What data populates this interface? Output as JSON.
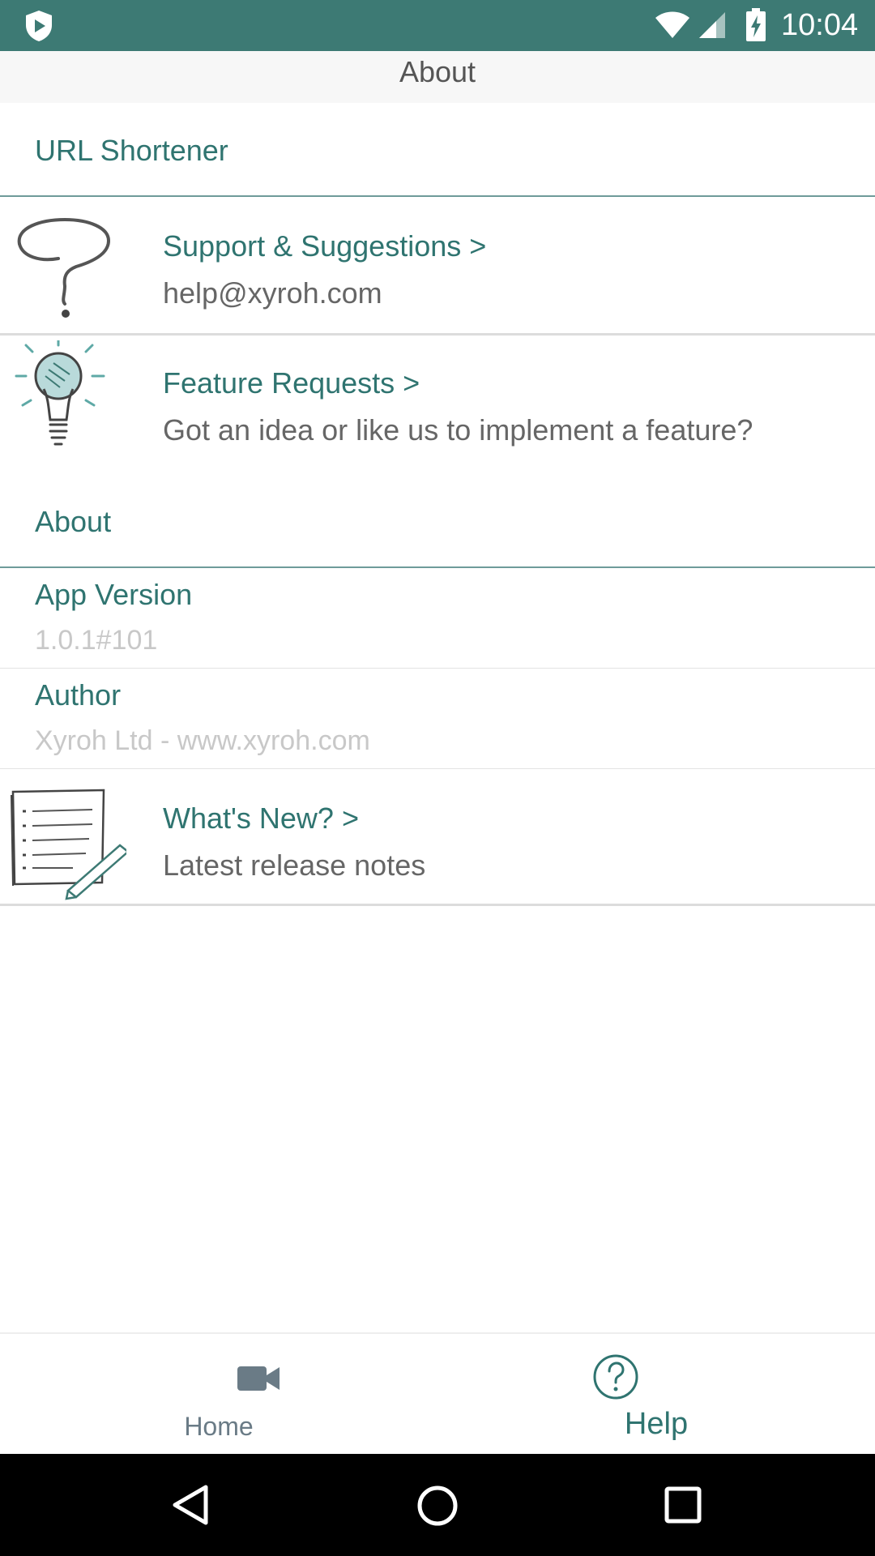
{
  "status_bar": {
    "time": "10:04",
    "icons": [
      "shield-play-icon",
      "wifi-icon",
      "cell-signal-icon",
      "battery-charging-icon"
    ],
    "background": "#3d7a74"
  },
  "header": {
    "title": "About"
  },
  "sections": {
    "app_name": "URL Shortener",
    "about": "About"
  },
  "support": {
    "title": "Support & Suggestions >",
    "subtitle": "help@xyroh.com",
    "icon": "question-mark-sketch-icon"
  },
  "feature_requests": {
    "title": "Feature Requests >",
    "subtitle": "Got an idea or like us to implement a feature?",
    "icon": "lightbulb-sketch-icon"
  },
  "app_version": {
    "label": "App Version",
    "value": "1.0.1#101"
  },
  "author": {
    "label": "Author",
    "value": "Xyroh Ltd - www.xyroh.com"
  },
  "whats_new": {
    "title": "What's New? >",
    "subtitle": "Latest release notes",
    "icon": "notepad-pencil-sketch-icon"
  },
  "bottom_nav": {
    "home_label": "Home",
    "help_label": "Help",
    "home_icon": "video-camera-icon",
    "help_icon": "question-circle-icon",
    "active": "Help"
  },
  "system_nav": {
    "icons": [
      "back-icon",
      "home-circle-icon",
      "recents-icon"
    ]
  },
  "colors": {
    "accent": "#2f7470",
    "title_text": "#555555",
    "muted_text": "#c8c8c8",
    "inactive_nav": "#6a7b86"
  }
}
